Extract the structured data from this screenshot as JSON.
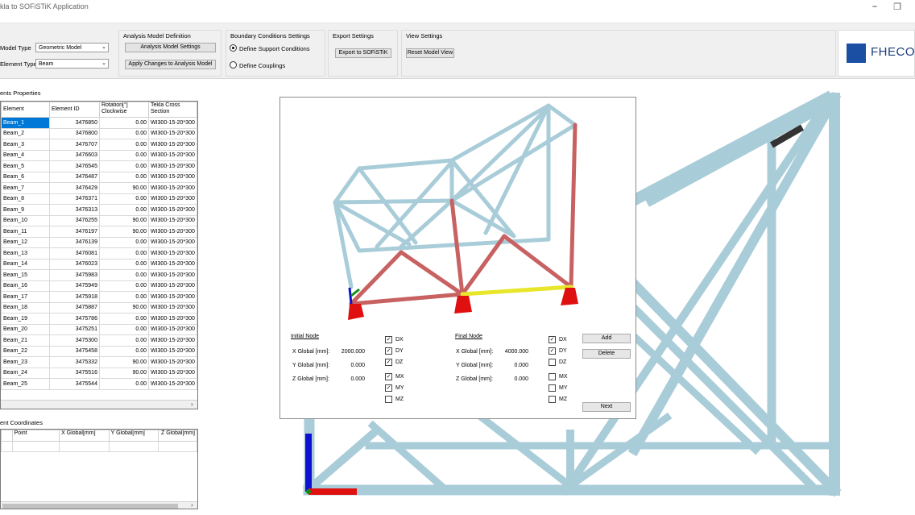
{
  "window": {
    "title": "kla to SOFiSTiK Application",
    "minimize_glyph": "⎯",
    "restore_glyph": "❐"
  },
  "ribbon": {
    "model_type_label": "Model Type",
    "model_type_value": "Geometric Model",
    "element_type_label": "Element Type",
    "element_type_value": "Beam",
    "analysis_group_title": "Analysis Model Definition",
    "analysis_settings_btn": "Analysis Model Settings",
    "apply_changes_btn": "Apply Changes to Analysis Model",
    "boundary_group_title": "Boundary Conditions Settings",
    "define_supports_label": "Define Support Conditions",
    "define_couplings_label": "Define Couplings",
    "export_group_title": "Export Settings",
    "export_btn": "Export to SOFiSTiK",
    "view_group_title": "View Settings",
    "reset_view_btn": "Reset Model View",
    "logo_text": "FHECOR"
  },
  "elements_panel": {
    "title": "ents Properties",
    "columns": [
      "Element",
      "Element ID",
      "Rotation[°] Clockwise",
      "Tekla Cross Section"
    ],
    "rows": [
      [
        "Beam_1",
        "3476850",
        "0.00",
        "WI300-15-20*300"
      ],
      [
        "Beam_2",
        "3476800",
        "0.00",
        "WI300-15-20*300"
      ],
      [
        "Beam_3",
        "3476707",
        "0.00",
        "WI300-15-20*300"
      ],
      [
        "Beam_4",
        "3476603",
        "0.00",
        "WI300-15-20*300"
      ],
      [
        "Beam_5",
        "3476545",
        "0.00",
        "WI300-15-20*300"
      ],
      [
        "Beam_6",
        "3476487",
        "0.00",
        "WI300-15-20*300"
      ],
      [
        "Beam_7",
        "3476429",
        "90.00",
        "WI300-15-20*300"
      ],
      [
        "Beam_8",
        "3476371",
        "0.00",
        "WI300-15-20*300"
      ],
      [
        "Beam_9",
        "3476313",
        "0.00",
        "WI300-15-20*300"
      ],
      [
        "Beam_10",
        "3476255",
        "90.00",
        "WI300-15-20*300"
      ],
      [
        "Beam_11",
        "3476197",
        "90.00",
        "WI300-15-20*300"
      ],
      [
        "Beam_12",
        "3476139",
        "0.00",
        "WI300-15-20*300"
      ],
      [
        "Beam_13",
        "3476081",
        "0.00",
        "WI300-15-20*300"
      ],
      [
        "Beam_14",
        "3476023",
        "0.00",
        "WI300-15-20*300"
      ],
      [
        "Beam_15",
        "3475983",
        "0.00",
        "WI300-15-20*300"
      ],
      [
        "Beam_16",
        "3475949",
        "0.00",
        "WI300-15-20*300"
      ],
      [
        "Beam_17",
        "3475918",
        "0.00",
        "WI300-15-20*300"
      ],
      [
        "Beam_18",
        "3475887",
        "90.00",
        "WI300-15-20*300"
      ],
      [
        "Beam_19",
        "3475786",
        "0.00",
        "WI300-15-20*300"
      ],
      [
        "Beam_20",
        "3475251",
        "0.00",
        "WI300-15-20*300"
      ],
      [
        "Beam_21",
        "3475300",
        "0.00",
        "WI300-15-20*300"
      ],
      [
        "Beam_22",
        "3475458",
        "0.00",
        "WI300-15-20*300"
      ],
      [
        "Beam_23",
        "3475332",
        "90.00",
        "WI300-15-20*300"
      ],
      [
        "Beam_24",
        "3475516",
        "90.00",
        "WI300-15-20*300"
      ],
      [
        "Beam_25",
        "3475544",
        "0.00",
        "WI300-15-20*300"
      ]
    ],
    "selected_row": 0
  },
  "coords_panel": {
    "title": "ent Coordinates",
    "columns": [
      "Point",
      "X Global[mm]",
      "Y Global[mm]",
      "Z Global[mm]"
    ]
  },
  "dialog": {
    "initial_node_title": "Initial Node",
    "final_node_title": "Final Node",
    "x_label": "X Global [mm]:",
    "y_label": "Y Global [mm]:",
    "z_label": "Z Global [mm]:",
    "initial": {
      "x": "2000.000",
      "y": "0.000",
      "z": "0.000"
    },
    "final": {
      "x": "4000.000",
      "y": "0.000",
      "z": "0.000"
    },
    "initial_checks": [
      {
        "label": "DX",
        "checked": true
      },
      {
        "label": "DY",
        "checked": true
      },
      {
        "label": "DZ",
        "checked": true
      },
      {
        "label": "MX",
        "checked": true
      },
      {
        "label": "MY",
        "checked": true
      },
      {
        "label": "MZ",
        "checked": false
      }
    ],
    "final_checks": [
      {
        "label": "DX",
        "checked": true
      },
      {
        "label": "DY",
        "checked": true
      },
      {
        "label": "DZ",
        "checked": false
      },
      {
        "label": "MX",
        "checked": false
      },
      {
        "label": "MY",
        "checked": false
      },
      {
        "label": "MZ",
        "checked": false
      }
    ],
    "add_btn": "Add",
    "delete_btn": "Delete",
    "next_btn": "Next"
  },
  "colors": {
    "beam": "#a9ccd9",
    "selected": "#c86161",
    "highlight": "#e8e62a",
    "support": "#e01010",
    "accent": "#0078d7"
  }
}
